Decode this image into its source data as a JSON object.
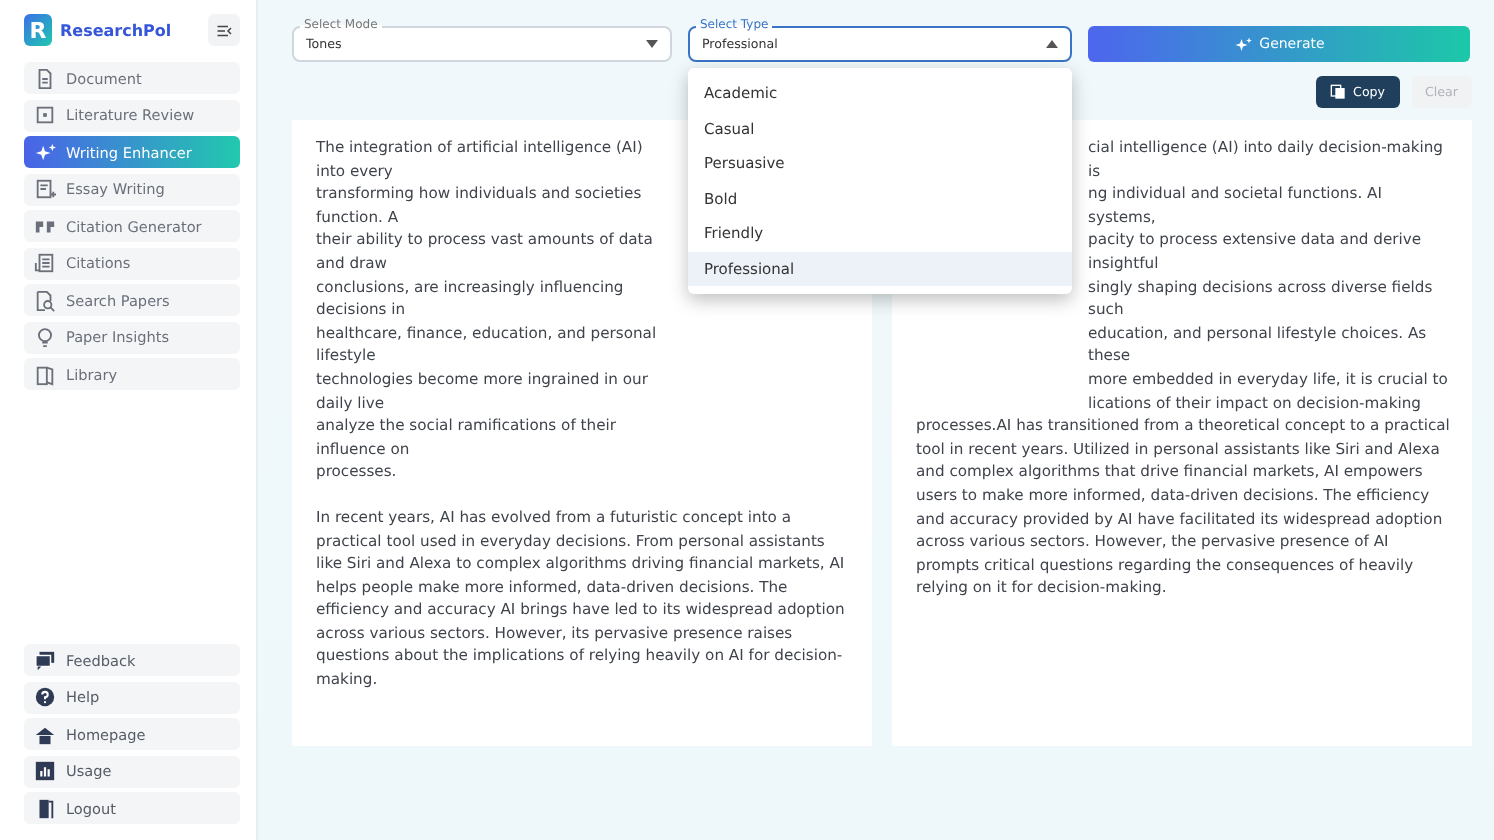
{
  "sidebar": {
    "logo": {
      "letter": "R",
      "name": "ResearchPol"
    },
    "items": [
      {
        "label": "Document",
        "selected": false
      },
      {
        "label": "Literature Review",
        "selected": false
      },
      {
        "label": "Writing Enhancer",
        "selected": true
      },
      {
        "label": "Essay Writing",
        "selected": false
      },
      {
        "label": "Citation Generator",
        "selected": false
      },
      {
        "label": "Citations",
        "selected": false
      },
      {
        "label": "Search Papers",
        "selected": false
      },
      {
        "label": "Paper Insights",
        "selected": false
      },
      {
        "label": "Library",
        "selected": false
      }
    ],
    "bottom_items": [
      {
        "label": "Feedback"
      },
      {
        "label": "Help"
      },
      {
        "label": "Homepage"
      },
      {
        "label": "Usage"
      },
      {
        "label": "Logout"
      }
    ]
  },
  "toolbar": {
    "mode": {
      "label": "Select Mode",
      "value": "Tones"
    },
    "type": {
      "label": "Select Type",
      "value": "Professional",
      "expanded": true,
      "options": [
        {
          "label": "Academic",
          "selected": false
        },
        {
          "label": "Casual",
          "selected": false
        },
        {
          "label": "Persuasive",
          "selected": false
        },
        {
          "label": "Bold",
          "selected": false
        },
        {
          "label": "Friendly",
          "selected": false
        },
        {
          "label": "Professional",
          "selected": true
        }
      ]
    },
    "generate": "Generate",
    "copy": "Copy",
    "clear": {
      "label": "Clear",
      "disabled": true
    }
  },
  "input_text": {
    "partial_lines": [
      "The integration of artificial intelligence (AI) into every",
      "transforming how individuals and societies function. A",
      "their ability to process vast amounts of data and draw",
      "conclusions, are increasingly influencing decisions in",
      "healthcare, finance, education, and personal lifestyle",
      "technologies become more ingrained in our daily live",
      "analyze the social ramifications of their influence on",
      "processes."
    ],
    "paragraphs": [
      "In recent years, AI has evolved from a futuristic concept into a practical tool used in everyday decisions. From personal assistants like Siri and Alexa to complex algorithms driving financial markets, AI helps people make more informed, data-driven decisions. The efficiency and accuracy AI brings have led to its widespread adoption across various sectors. However, its pervasive presence raises questions about the implications of relying heavily on AI for decision-making."
    ]
  },
  "output_text": {
    "partial_lines": [
      "cial intelligence (AI) into daily decision-making is",
      "ng individual and societal functions. AI systems,",
      "pacity to process extensive data and derive insightful",
      "singly shaping decisions across diverse fields such",
      "education, and personal lifestyle choices. As these",
      "more embedded in everyday life, it is crucial to",
      "lications of their impact on decision-making"
    ],
    "paragraphs": [
      "processes.AI has transitioned from a theoretical concept to a practical tool in recent years. Utilized in personal assistants like Siri and Alexa and complex algorithms that drive financial markets, AI empowers users to make more informed, data-driven decisions. The efficiency and accuracy provided by AI have facilitated its widespread adoption across various sectors. However, the pervasive presence of AI prompts critical questions regarding the consequences of heavily relying on it for decision-making."
    ]
  }
}
